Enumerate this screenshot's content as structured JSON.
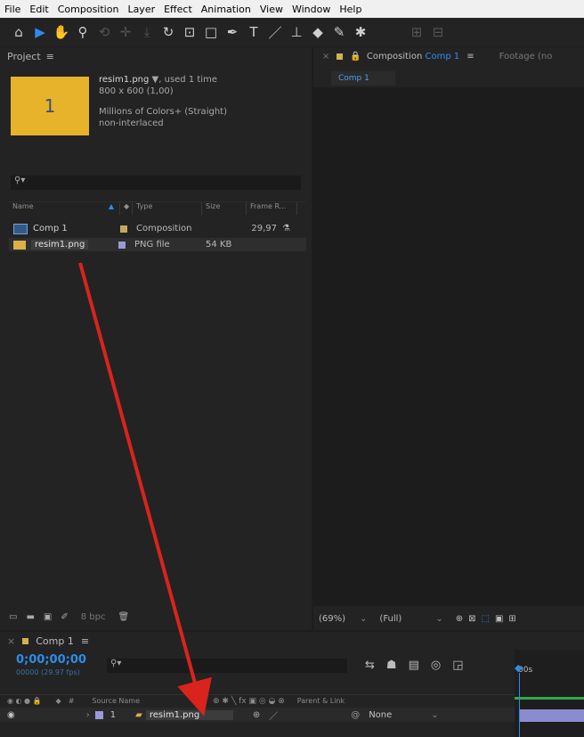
{
  "menu": [
    "File",
    "Edit",
    "Composition",
    "Layer",
    "Effect",
    "Animation",
    "View",
    "Window",
    "Help"
  ],
  "project": {
    "title": "Project",
    "thumb_label": "1",
    "item_name": "resim1.png",
    "used_text": ", used 1 time",
    "dimensions": "800 x 600 (1,00)",
    "color_info": "Millions of Colors+ (Straight)",
    "interlace": "non-interlaced",
    "columns": [
      "Name",
      "Type",
      "Size",
      "Frame R..."
    ],
    "items": [
      {
        "name": "Comp 1",
        "type": "Composition",
        "size": "",
        "frame_rate": "29,97"
      },
      {
        "name": "resim1.png",
        "type": "PNG file",
        "size": "54 KB",
        "frame_rate": ""
      }
    ],
    "bpc": "8 bpc"
  },
  "composition": {
    "tab_prefix": "Composition",
    "tab_name": "Comp 1",
    "footage_tab": "Footage (no",
    "breadcrumb": "Comp 1",
    "zoom": "(69%)",
    "resolution": "(Full)"
  },
  "timeline": {
    "tab": "Comp 1",
    "timecode": "0;00;00;00",
    "fps": "00000 (29.97 fps)",
    "ruler_start": "00s",
    "col_source_name": "Source Name",
    "col_parent": "Parent & Link",
    "layer_index": "1",
    "layer_name": "resim1.png",
    "parent_value": "None"
  },
  "colors": {
    "accent": "#2d8ceb",
    "thumb": "#e7b32b",
    "arrow": "#d8241c",
    "timecode": "#2d8ceb"
  }
}
